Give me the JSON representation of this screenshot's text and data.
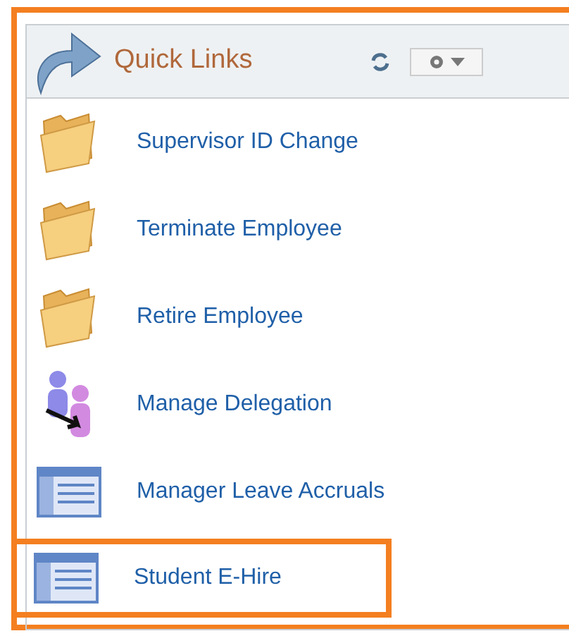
{
  "panel": {
    "title": "Quick Links"
  },
  "links": [
    {
      "label": "Supervisor ID Change",
      "kind": "folder",
      "highlighted": false
    },
    {
      "label": "Terminate Employee",
      "kind": "folder",
      "highlighted": false
    },
    {
      "label": "Retire Employee",
      "kind": "folder",
      "highlighted": false
    },
    {
      "label": "Manage Delegation",
      "kind": "delegation",
      "highlighted": false
    },
    {
      "label": "Manager Leave Accruals",
      "kind": "page",
      "highlighted": false
    },
    {
      "label": "Student E-Hire",
      "kind": "page",
      "highlighted": true
    }
  ]
}
